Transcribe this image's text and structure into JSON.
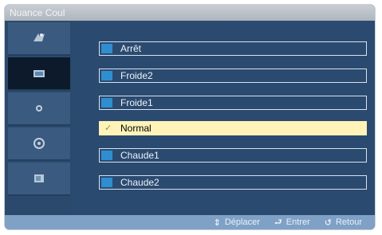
{
  "window": {
    "title": "Nuance Coul"
  },
  "sidebar": {
    "items": [
      {
        "icon": "picture-icon"
      },
      {
        "icon": "tv-icon",
        "active": true
      },
      {
        "icon": "sound-icon"
      },
      {
        "icon": "setup-icon"
      },
      {
        "icon": "input-icon"
      }
    ]
  },
  "options": [
    {
      "label": "Arrêt"
    },
    {
      "label": "Froide2"
    },
    {
      "label": "Froide1"
    },
    {
      "label": "Normal",
      "selected": true
    },
    {
      "label": "Chaude1"
    },
    {
      "label": "Chaude2"
    }
  ],
  "footer": {
    "move_icon": "⇕",
    "move_label": "Déplacer",
    "enter_icon": "⮐",
    "enter_label": "Entrer",
    "return_icon": "↺",
    "return_label": "Retour"
  },
  "colors": {
    "accent": "#2f8ed0",
    "selected": "#fff3b8",
    "panel": "#2b4a70"
  }
}
